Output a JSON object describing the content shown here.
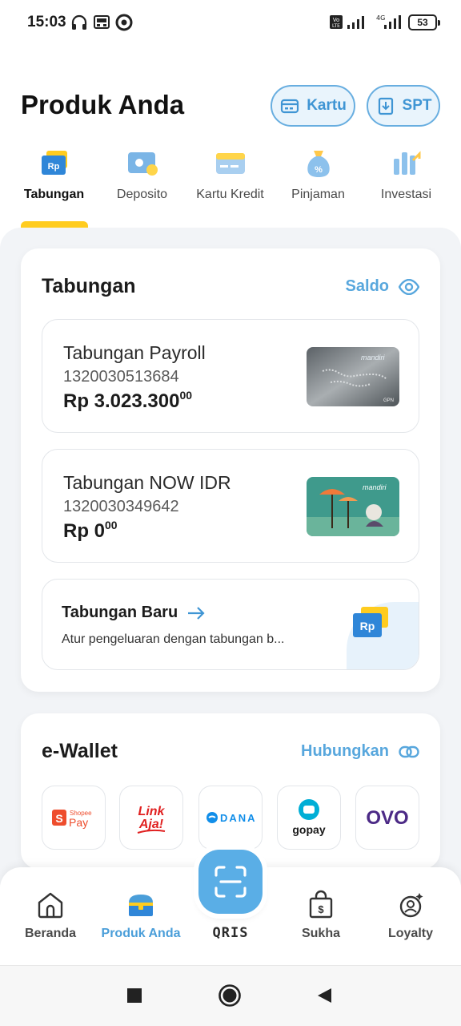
{
  "status_bar": {
    "time": "15:03",
    "battery": "53"
  },
  "header": {
    "title": "Produk Anda",
    "buttons": [
      {
        "label": "Kartu",
        "icon": "card-icon"
      },
      {
        "label": "SPT",
        "icon": "document-icon"
      }
    ]
  },
  "product_tabs": [
    {
      "label": "Tabungan",
      "icon": "savings-icon",
      "active": true
    },
    {
      "label": "Deposito",
      "icon": "deposit-icon",
      "active": false
    },
    {
      "label": "Kartu Kredit",
      "icon": "credit-card-icon",
      "active": false
    },
    {
      "label": "Pinjaman",
      "icon": "loan-bag-icon",
      "active": false
    },
    {
      "label": "Investasi",
      "icon": "investment-chart-icon",
      "active": false
    }
  ],
  "savings": {
    "title": "Tabungan",
    "saldo_label": "Saldo",
    "accounts": [
      {
        "name": "Tabungan Payroll",
        "number": "1320030513684",
        "balance": "Rp 3.023.300",
        "cents": "00",
        "card_brand": "mandiri",
        "card_mark": "GPN"
      },
      {
        "name": "Tabungan NOW IDR",
        "number": "1320030349642",
        "balance": "Rp 0",
        "cents": "00",
        "card_brand": "mandiri"
      }
    ],
    "new_savings": {
      "title": "Tabungan Baru",
      "subtitle": "Atur pengeluaran dengan tabungan b...",
      "badge": "Rp"
    }
  },
  "ewallet": {
    "title": "e-Wallet",
    "link_label": "Hubungkan",
    "items": [
      {
        "brand_small": "Shopee",
        "brand_big": "Pay"
      },
      {
        "line1": "Link",
        "line2": "Aja!"
      },
      {
        "label": "DANA"
      },
      {
        "label": "gopay"
      },
      {
        "label": "OVO"
      }
    ]
  },
  "bottom_nav": [
    {
      "label": "Beranda",
      "icon": "home-icon",
      "active": false
    },
    {
      "label": "Produk Anda",
      "icon": "treasure-chest-icon",
      "active": true
    },
    {
      "label": "Sukha",
      "icon": "shopping-bag-icon",
      "active": false
    },
    {
      "label": "Loyalty",
      "icon": "loyalty-icon",
      "active": false
    }
  ],
  "qris": {
    "label": "QRIS"
  },
  "colors": {
    "accent_blue": "#58a7dd",
    "tab_indicator": "#ffcc1f",
    "background": "#f2f4f7"
  }
}
